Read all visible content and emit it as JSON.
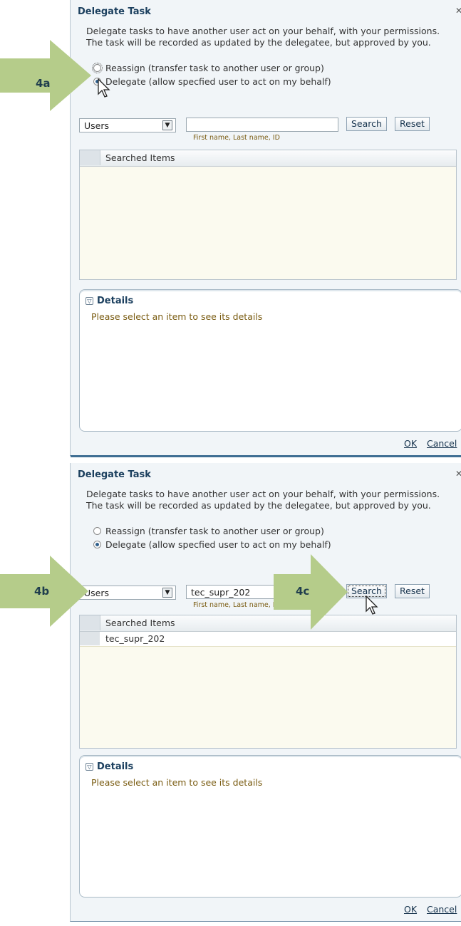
{
  "dialog": {
    "title": "Delegate Task",
    "close_icon": "close-icon",
    "description_line1": "Delegate tasks to have another user act on your behalf, with your permissions.",
    "description_line2": "The task will be recorded as updated by the delegatee, but approved by you.",
    "option_reassign": "Reassign (transfer task to another user or group)",
    "option_delegate": "Delegate (allow specfied user to act on my behalf)",
    "type_select_value": "Users",
    "search_hint": "First name, Last name, ID",
    "search_button": "Search",
    "reset_button": "Reset",
    "table_header": "Searched Items",
    "details_title": "Details",
    "details_message": "Please select an item to see its details",
    "ok_button": "OK",
    "cancel_button": "Cancel"
  },
  "step1": {
    "callout": "4a",
    "search_value": "",
    "results": []
  },
  "step2": {
    "callout_select": "4b",
    "callout_search": "4c",
    "search_value": "tec_supr_202",
    "results": [
      "tec_supr_202"
    ]
  },
  "colors": {
    "callout_green": "#b5cc8a",
    "dialog_bg": "#f1f5f8",
    "title_blue": "#1b3f5e",
    "hint_brown": "#7a5c12"
  }
}
